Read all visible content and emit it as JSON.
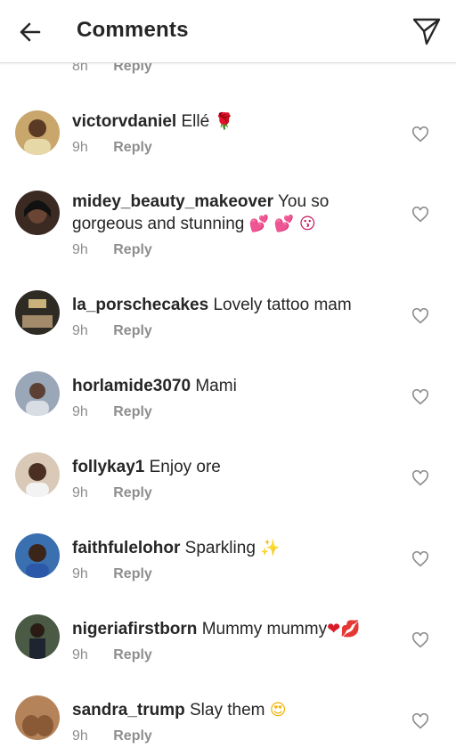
{
  "header": {
    "title": "Comments",
    "back_icon": "arrow-left-icon",
    "send_icon": "paper-plane-icon"
  },
  "partial_comment": {
    "time": "8h",
    "reply": "Reply"
  },
  "comments": [
    {
      "username": "victorvdaniel",
      "text": "Ellé ",
      "emoji": "🌹",
      "time": "9h",
      "reply": "Reply",
      "avatar_color": "#c9a66b"
    },
    {
      "username": "midey_beauty_makeover",
      "text": "You so gorgeous and stunning ",
      "emoji": "💕 💕 😗",
      "time": "9h",
      "reply": "Reply",
      "avatar_color": "#3b2a22"
    },
    {
      "username": "la_porschecakes",
      "text": "Lovely tattoo mam",
      "emoji": "",
      "time": "9h",
      "reply": "Reply",
      "avatar_color": "#2e2a24"
    },
    {
      "username": "horlamide3070",
      "text": "Mami",
      "emoji": "",
      "time": "9h",
      "reply": "Reply",
      "avatar_color": "#9aa7b8"
    },
    {
      "username": "follykay1",
      "text": "Enjoy ore",
      "emoji": "",
      "time": "9h",
      "reply": "Reply",
      "avatar_color": "#d9c9b6"
    },
    {
      "username": "faithfulelohor",
      "text": "Sparkling ",
      "emoji": "✨",
      "time": "9h",
      "reply": "Reply",
      "avatar_color": "#3a6fb0"
    },
    {
      "username": "nigeriafirstborn",
      "text": "Mummy mummy",
      "emoji": "❤💋",
      "time": "9h",
      "reply": "Reply",
      "avatar_color": "#4a5a44"
    },
    {
      "username": "sandra_trump",
      "text": "Slay them ",
      "emoji": "😍",
      "time": "9h",
      "reply": "Reply",
      "avatar_color": "#b5835a"
    }
  ]
}
